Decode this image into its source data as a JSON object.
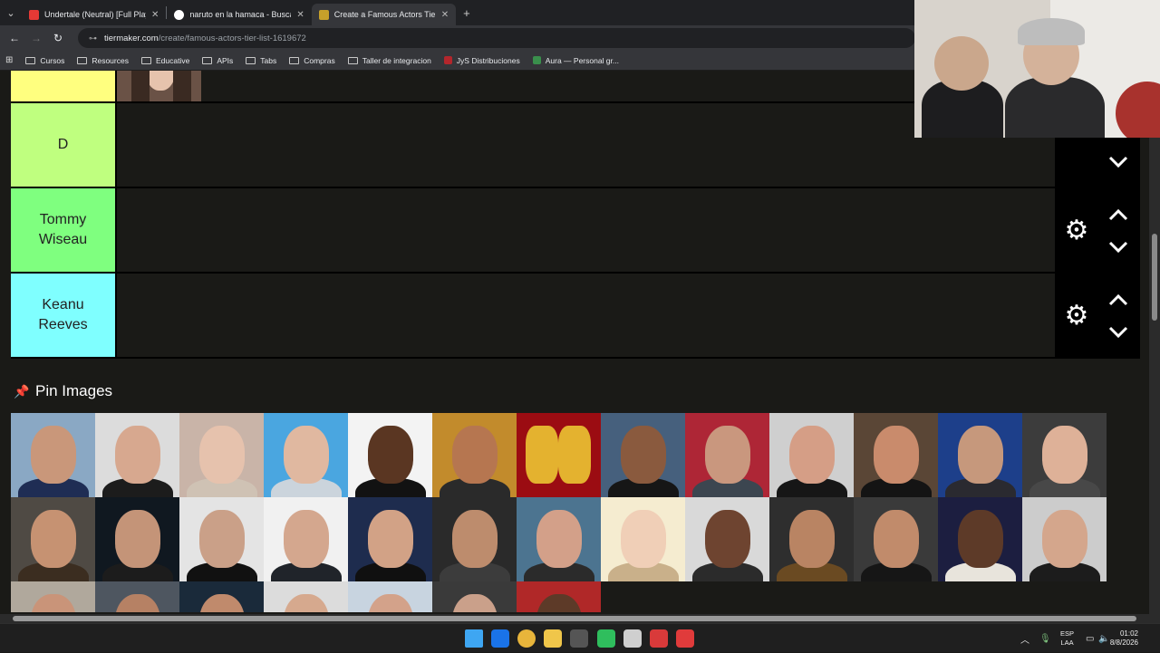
{
  "browser": {
    "tabs": [
      {
        "title": "Undertale (Neutral) [Full Playthr",
        "favicon_color": "#e53935",
        "active": false
      },
      {
        "title": "naruto en la hamaca - Buscar co",
        "favicon_color": "#ffffff",
        "active": false
      },
      {
        "title": "Create a Famous Actors Tier List",
        "favicon_color": "#c6a02a",
        "active": true
      }
    ],
    "close_glyph": "✕",
    "new_tab_glyph": "+",
    "menu_glyph": "⌄",
    "back_glyph": "←",
    "forward_glyph": "→",
    "reload_glyph": "↻",
    "url_host": "tiermaker.com",
    "url_path": "/create/famous-actors-tier-list-1619672",
    "bookmarks": [
      {
        "label": "Cursos",
        "icon": "folder-icon"
      },
      {
        "label": "Resources",
        "icon": "folder-icon"
      },
      {
        "label": "Educative",
        "icon": "folder-icon"
      },
      {
        "label": "APIs",
        "icon": "folder-icon"
      },
      {
        "label": "Tabs",
        "icon": "folder-icon"
      },
      {
        "label": "Compras",
        "icon": "folder-icon"
      },
      {
        "label": "Taller de integracion",
        "icon": "folder-icon"
      },
      {
        "label": "JyS Distribuciones",
        "icon": "site-icon",
        "color": "#b3262c"
      },
      {
        "label": "Aura — Personal gr...",
        "icon": "site-icon",
        "color": "#3a8f4c"
      }
    ]
  },
  "tiers": [
    {
      "label": "",
      "color": "#ffff7f",
      "partial": true
    },
    {
      "label": "D",
      "color": "#bfff7f"
    },
    {
      "label": "Tommy Wiseau",
      "color": "#7fff7f"
    },
    {
      "label": "Keanu Reeves",
      "color": "#7fffff"
    }
  ],
  "pin": {
    "title": "Pin Images"
  },
  "image_pool": {
    "rows": [
      [
        {
          "bg": "#8aa8c4",
          "skin": "#c9977a",
          "cloth": "#1f2d54"
        },
        {
          "bg": "#dcdcdc",
          "skin": "#d7a88f",
          "cloth": "#1c1c1c"
        },
        {
          "bg": "#c9b4a8",
          "skin": "#e6c2ad",
          "cloth": "#cfc2b4"
        },
        {
          "bg": "#4aa6e0",
          "skin": "#e0b8a0",
          "cloth": "#cbd4dc"
        },
        {
          "bg": "#f3f3f3",
          "skin": "#5a3622",
          "cloth": "#121212"
        },
        {
          "bg": "#c28b2c",
          "skin": "#b67650",
          "cloth": "#2a2a2a"
        },
        {
          "bg": "#9b0c12",
          "skin": "#e4b22f",
          "cloth": "#9b0c12"
        },
        {
          "bg": "#46607d",
          "skin": "#8a5a3e",
          "cloth": "#161616"
        },
        {
          "bg": "#ae2636",
          "skin": "#c9977e",
          "cloth": "#3c4650"
        },
        {
          "bg": "#cfcfcf",
          "skin": "#d59e86",
          "cloth": "#161616"
        },
        {
          "bg": "#5a4636",
          "skin": "#c98b6c",
          "cloth": "#141414"
        },
        {
          "bg": "#1d3f8a",
          "skin": "#c6987c",
          "cloth": "#2a2a30"
        },
        {
          "bg": "#3c3c3c",
          "skin": "#deb198",
          "cloth": "#484848"
        }
      ],
      [
        {
          "bg": "#4f4a44",
          "skin": "#c69272",
          "cloth": "#3b2d20"
        },
        {
          "bg": "#101820",
          "skin": "#c49478",
          "cloth": "#1c1c1c"
        },
        {
          "bg": "#e4e4e4",
          "skin": "#caa088",
          "cloth": "#111111"
        },
        {
          "bg": "#f1f1f1",
          "skin": "#d4a78e",
          "cloth": "#20242a"
        },
        {
          "bg": "#1e2c4e",
          "skin": "#d2a286",
          "cloth": "#101010"
        },
        {
          "bg": "#2a2a2a",
          "skin": "#bd8c6d",
          "cloth": "#3c3c3c"
        },
        {
          "bg": "#4c7490",
          "skin": "#d3a089",
          "cloth": "#2b2b2b"
        },
        {
          "bg": "#f5ecd0",
          "skin": "#f0cfb7",
          "cloth": "#c9b08a"
        },
        {
          "bg": "#d9d9d9",
          "skin": "#6e4430",
          "cloth": "#2b2b2b"
        },
        {
          "bg": "#2e2e2e",
          "skin": "#b98463",
          "cloth": "#6a4a22"
        },
        {
          "bg": "#3a3a3a",
          "skin": "#c18b6b",
          "cloth": "#161616"
        },
        {
          "bg": "#1c1e40",
          "skin": "#5d3a28",
          "cloth": "#e8e4dc"
        },
        {
          "bg": "#cccccc",
          "skin": "#d4a68c",
          "cloth": "#1c1c1c"
        }
      ],
      [
        {
          "bg": "#b0a89c",
          "skin": "#c99479",
          "cloth": "#6a6a6a"
        },
        {
          "bg": "#4e5660",
          "skin": "#b68164",
          "cloth": "#222222"
        },
        {
          "bg": "#1a2a3a",
          "skin": "#c08a6c",
          "cloth": "#1a1a1a"
        },
        {
          "bg": "#dcdcdc",
          "skin": "#d6a98e",
          "cloth": "#222222"
        },
        {
          "bg": "#c8d4e0",
          "skin": "#d3a28a",
          "cloth": "#333333"
        },
        {
          "bg": "#3a3a3a",
          "skin": "#caa08a",
          "cloth": "#2a2a2a"
        },
        {
          "bg": "#b02828",
          "skin": "#5d3a28",
          "cloth": "#222222"
        }
      ]
    ]
  },
  "taskbar": {
    "lang_top": "ESP",
    "lang_bottom": "LAA",
    "time": "01:02",
    "date": "8/8/2026",
    "apps": [
      {
        "name": "windows-start-icon",
        "color": "#3ea6f2"
      },
      {
        "name": "mail-icon",
        "color": "#1a73e8"
      },
      {
        "name": "chrome-icon",
        "color": "#e8b53b"
      },
      {
        "name": "file-explorer-icon",
        "color": "#f0c64a"
      },
      {
        "name": "app-dark-icon",
        "color": "#555555"
      },
      {
        "name": "whatsapp-icon",
        "color": "#2fbe5d"
      },
      {
        "name": "openai-icon",
        "color": "#cfcfcf"
      },
      {
        "name": "app-red-icon",
        "color": "#d93a3a"
      },
      {
        "name": "app-bolt-icon",
        "color": "#e03b3b"
      }
    ]
  }
}
